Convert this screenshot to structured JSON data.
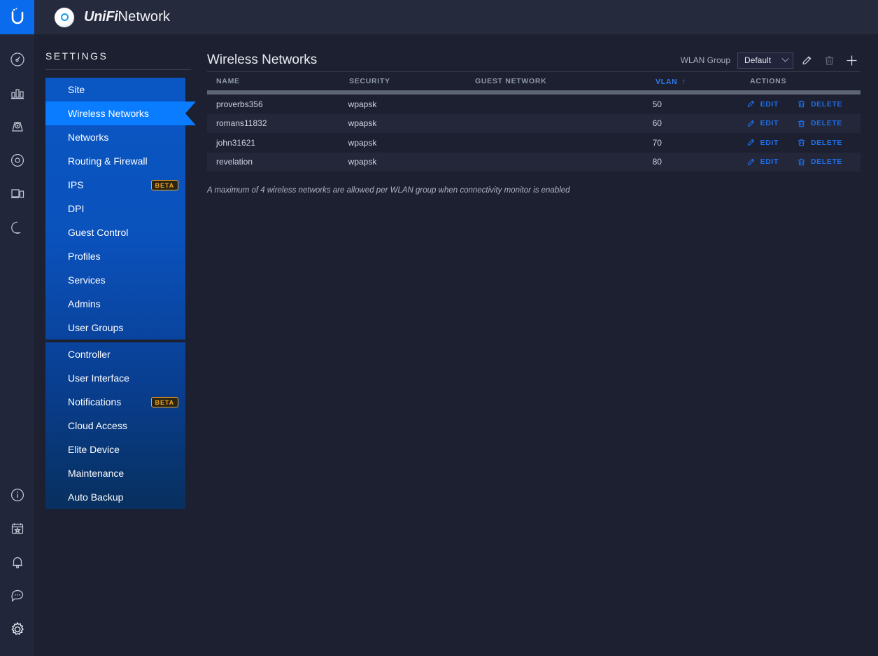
{
  "header": {
    "brand_unifi": "UniFi",
    "brand_network": "Network",
    "ap_icon": "access-point-icon"
  },
  "rail": {
    "logo": "ubiquiti-logo",
    "top_icons": [
      {
        "name": "dashboard-gauge-icon"
      },
      {
        "name": "statistics-bar-chart-icon"
      },
      {
        "name": "map-pin-icon"
      },
      {
        "name": "devices-circle-icon"
      },
      {
        "name": "clients-screen-icon"
      },
      {
        "name": "insights-shape-icon"
      }
    ],
    "bottom_icons": [
      {
        "name": "info-icon"
      },
      {
        "name": "events-calendar-icon"
      },
      {
        "name": "alerts-bell-icon"
      },
      {
        "name": "chat-icon"
      },
      {
        "name": "settings-gear-icon"
      }
    ]
  },
  "sidebar": {
    "title": "SETTINGS",
    "groups": [
      {
        "items": [
          {
            "label": "Site",
            "active": false,
            "badge": null
          },
          {
            "label": "Wireless Networks",
            "active": true,
            "badge": null
          },
          {
            "label": "Networks",
            "active": false,
            "badge": null
          },
          {
            "label": "Routing & Firewall",
            "active": false,
            "badge": null
          },
          {
            "label": "IPS",
            "active": false,
            "badge": "BETA"
          },
          {
            "label": "DPI",
            "active": false,
            "badge": null
          },
          {
            "label": "Guest Control",
            "active": false,
            "badge": null
          },
          {
            "label": "Profiles",
            "active": false,
            "badge": null
          },
          {
            "label": "Services",
            "active": false,
            "badge": null
          },
          {
            "label": "Admins",
            "active": false,
            "badge": null
          },
          {
            "label": "User Groups",
            "active": false,
            "badge": null
          }
        ]
      },
      {
        "items": [
          {
            "label": "Controller",
            "active": false,
            "badge": null
          },
          {
            "label": "User Interface",
            "active": false,
            "badge": null
          },
          {
            "label": "Notifications",
            "active": false,
            "badge": "BETA"
          },
          {
            "label": "Cloud Access",
            "active": false,
            "badge": null
          },
          {
            "label": "Elite Device",
            "active": false,
            "badge": null
          },
          {
            "label": "Maintenance",
            "active": false,
            "badge": null
          },
          {
            "label": "Auto Backup",
            "active": false,
            "badge": null
          }
        ]
      }
    ]
  },
  "main": {
    "page_title": "Wireless Networks",
    "wlan_group_label": "WLAN Group",
    "wlan_group_value": "Default",
    "tools": [
      {
        "name": "edit-wlan-group-button",
        "icon": "pencil-icon"
      },
      {
        "name": "delete-wlan-group-button",
        "icon": "trash-icon"
      },
      {
        "name": "add-wlan-group-button",
        "icon": "plus-icon"
      }
    ],
    "table": {
      "columns": [
        {
          "key": "name",
          "label": "NAME",
          "sorted": false
        },
        {
          "key": "security",
          "label": "SECURITY",
          "sorted": false
        },
        {
          "key": "guest",
          "label": "GUEST NETWORK",
          "sorted": false
        },
        {
          "key": "vlan",
          "label": "VLAN",
          "sorted": true,
          "sort_dir": "↑"
        },
        {
          "key": "actions",
          "label": "ACTIONS",
          "sorted": false
        }
      ],
      "rows": [
        {
          "name": "proverbs356",
          "security": "wpapsk",
          "guest": "",
          "vlan": "50"
        },
        {
          "name": "romans11832",
          "security": "wpapsk",
          "guest": "",
          "vlan": "60"
        },
        {
          "name": "john31621",
          "security": "wpapsk",
          "guest": "",
          "vlan": "70"
        },
        {
          "name": "revelation",
          "security": "wpapsk",
          "guest": "",
          "vlan": "80"
        }
      ],
      "action_edit": "EDIT",
      "action_delete": "DELETE"
    },
    "note": "A maximum of 4 wireless networks are allowed per WLAN group when connectivity monitor is enabled"
  },
  "colors": {
    "accent_blue": "#0a7cff",
    "menu_blue": "#0a57c4",
    "link_blue": "#1f6fe8",
    "badge_orange": "#f5a623",
    "bg_dark": "#1d2030"
  }
}
